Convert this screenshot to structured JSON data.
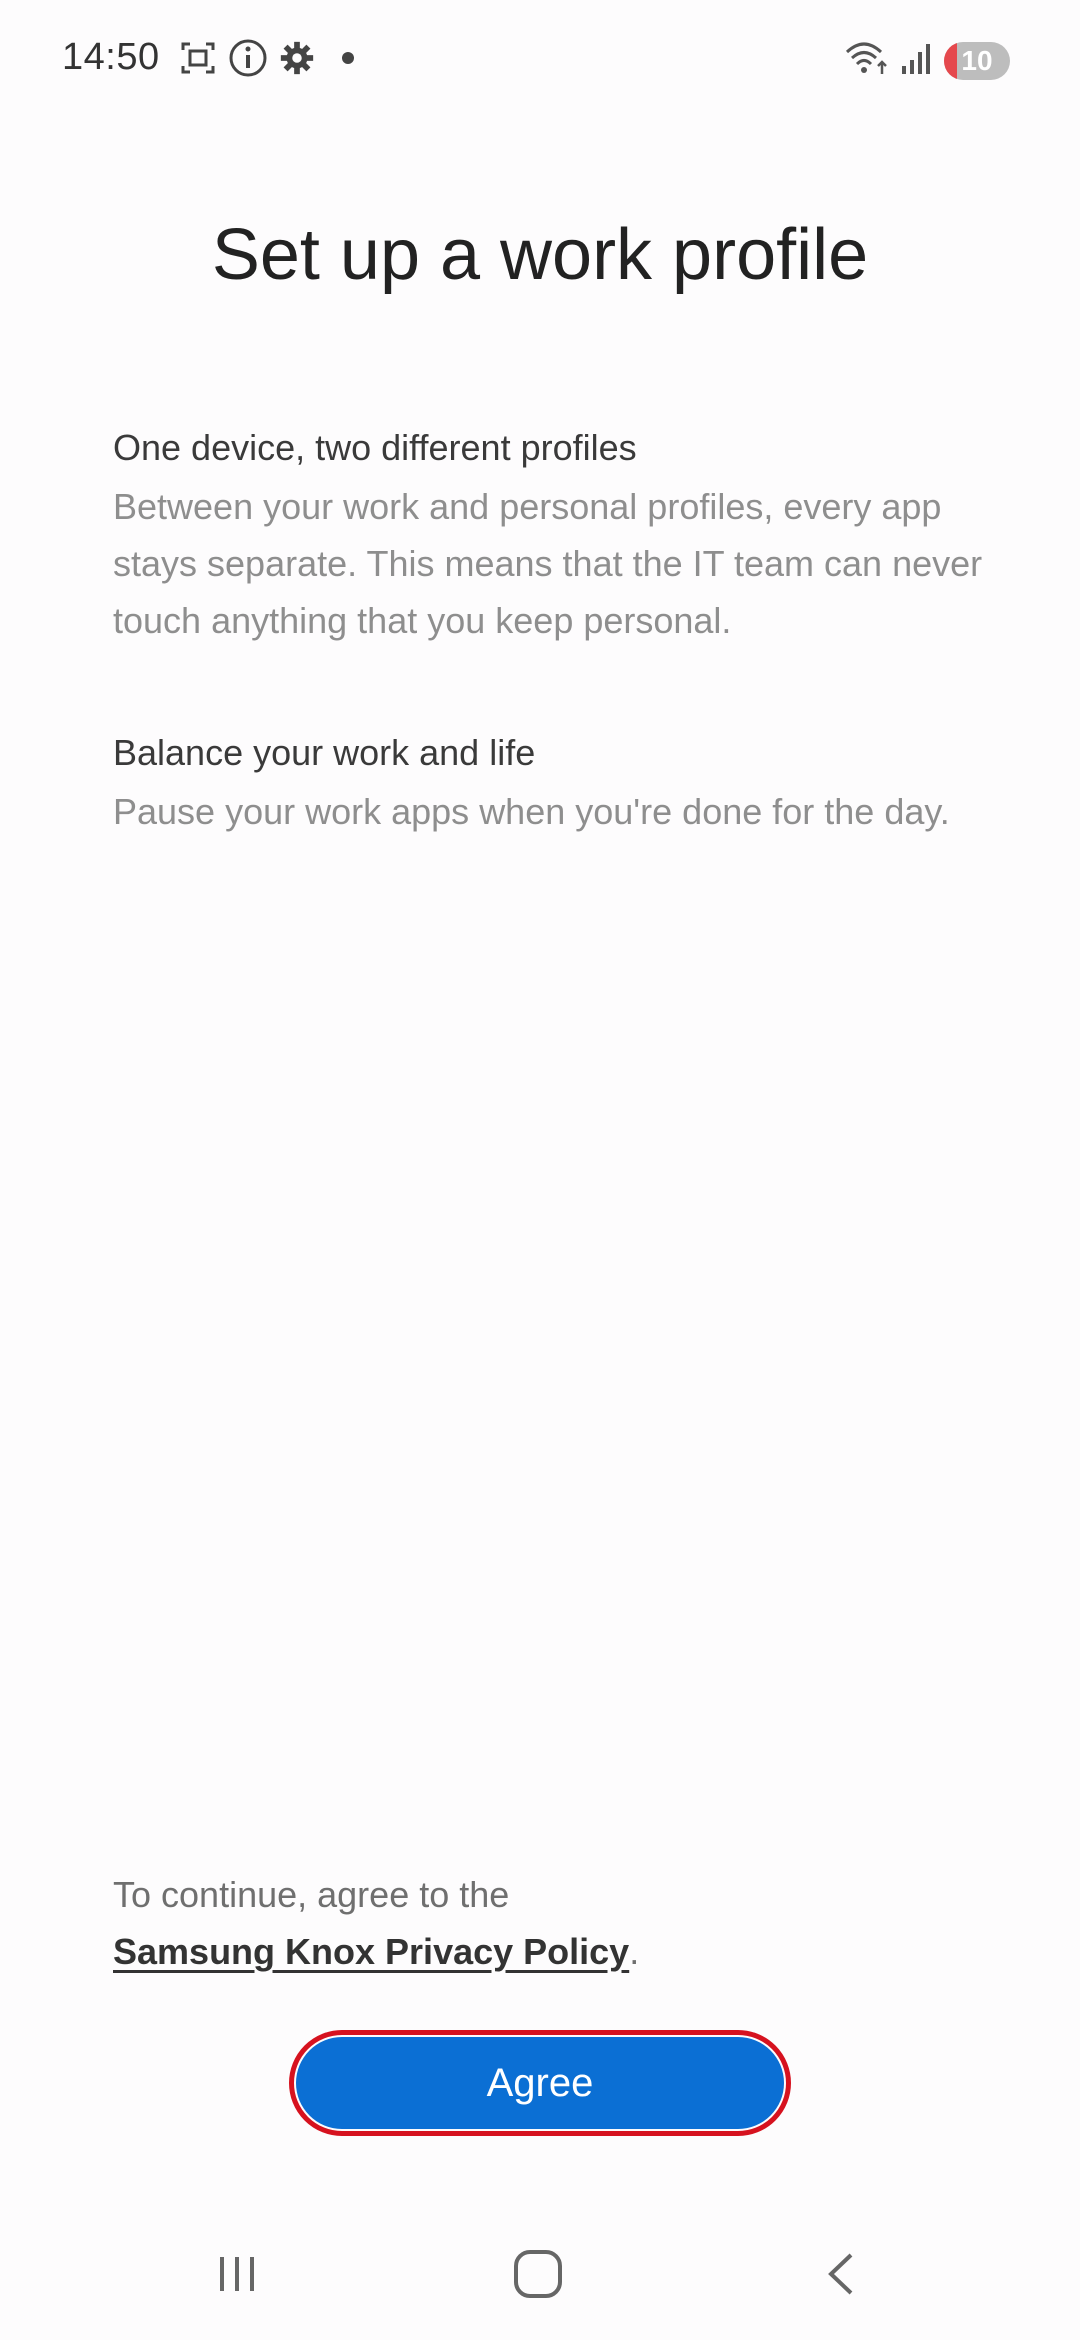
{
  "status_bar": {
    "time": "14:50",
    "battery_level": "10",
    "battery_fraction": 0.1,
    "icons_left": [
      "screenshot-icon",
      "info-icon",
      "settings-gear-icon",
      "notification-dot-icon"
    ],
    "icons_right": [
      "wifi-icon",
      "signal-icon",
      "battery-icon"
    ]
  },
  "page": {
    "title": "Set up a work profile"
  },
  "sections": [
    {
      "heading": "One device, two different profiles",
      "body": "Between your work and personal profiles, every app stays separate. This means that the IT team can never touch anything that you keep personal."
    },
    {
      "heading": "Balance your work and life",
      "body": "Pause your work apps when you're done for the day."
    }
  ],
  "consent": {
    "prefix": "To continue, agree to the",
    "link_text": "Samsung Knox Privacy Policy",
    "suffix": "."
  },
  "actions": {
    "agree_label": "Agree"
  },
  "nav_bar": {
    "buttons": [
      "recent-apps-icon",
      "home-icon",
      "back-icon"
    ]
  },
  "colors": {
    "accent": "#0b6fd4",
    "highlight_border": "#d6121f",
    "battery_low": "#e5484d"
  }
}
